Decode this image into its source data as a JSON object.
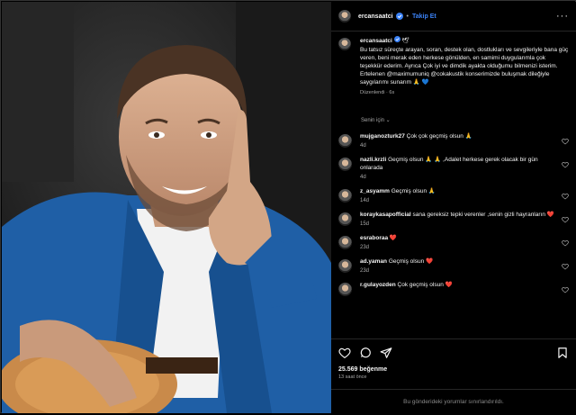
{
  "post": {
    "username": "ercansaatci",
    "follow_label": "Takip Et",
    "dot_separator": "•",
    "caption_username": "ercansaatci",
    "caption_emoji": "🕊",
    "caption_text": "Bu tatsız süreçte arayan, soran, destek olan, dostlukları ve sevgileriyle bana güç veren, beni merak eden herkese gönülden, en samimi duygularımla çok teşekkür ederim. Ayrıca Çok iyi ve dimdik ayakta olduğumu bilmenizi isterim. Ertelenen @maximumuniq @cokakustik konserimizde buluşmak dileğiyle saygılarımı sunarım 🙏 💙",
    "edited_label": "Düzenlendi · 6s",
    "language_label": "Senin için ⌄",
    "likes": "25.569 beğenme",
    "time_ago": "13 saat önce",
    "comments_closed": "Bu gönderideki yorumlar sınırlandırıldı."
  },
  "comments": [
    {
      "user": "mujganozturk27",
      "text": "Çok çok geçmiş olsun 🙏",
      "time": "4d"
    },
    {
      "user": "nazli.krzli",
      "text": "Geçmiş olsun 🙏 🙏 ,Adalet herkese gerek olacak bir gün onlarada",
      "time": "4d"
    },
    {
      "user": "z_asyamm",
      "text": "Geçmiş olsun 🙏",
      "time": "14d"
    },
    {
      "user": "koraykasapofficial",
      "text": "sana gereksiz tepki verenler ,senin gizli hayranların ❤️",
      "time": "15d"
    },
    {
      "user": "esraboraa",
      "text": "❤️",
      "time": "23d"
    },
    {
      "user": "ad.yaman",
      "text": "Geçmiş olsun ❤️",
      "time": "23d"
    },
    {
      "user": "r.gulayozden",
      "text": "Çok geçmiş olsun ❤️",
      "time": ""
    }
  ],
  "colors": {
    "background": "#000000",
    "link": "#3b82f6",
    "heart": "#ef4444",
    "jacket": "#1f5fa6"
  },
  "icons": [
    "verified-icon",
    "more-icon",
    "heart-icon",
    "comment-icon",
    "share-icon",
    "save-icon"
  ]
}
